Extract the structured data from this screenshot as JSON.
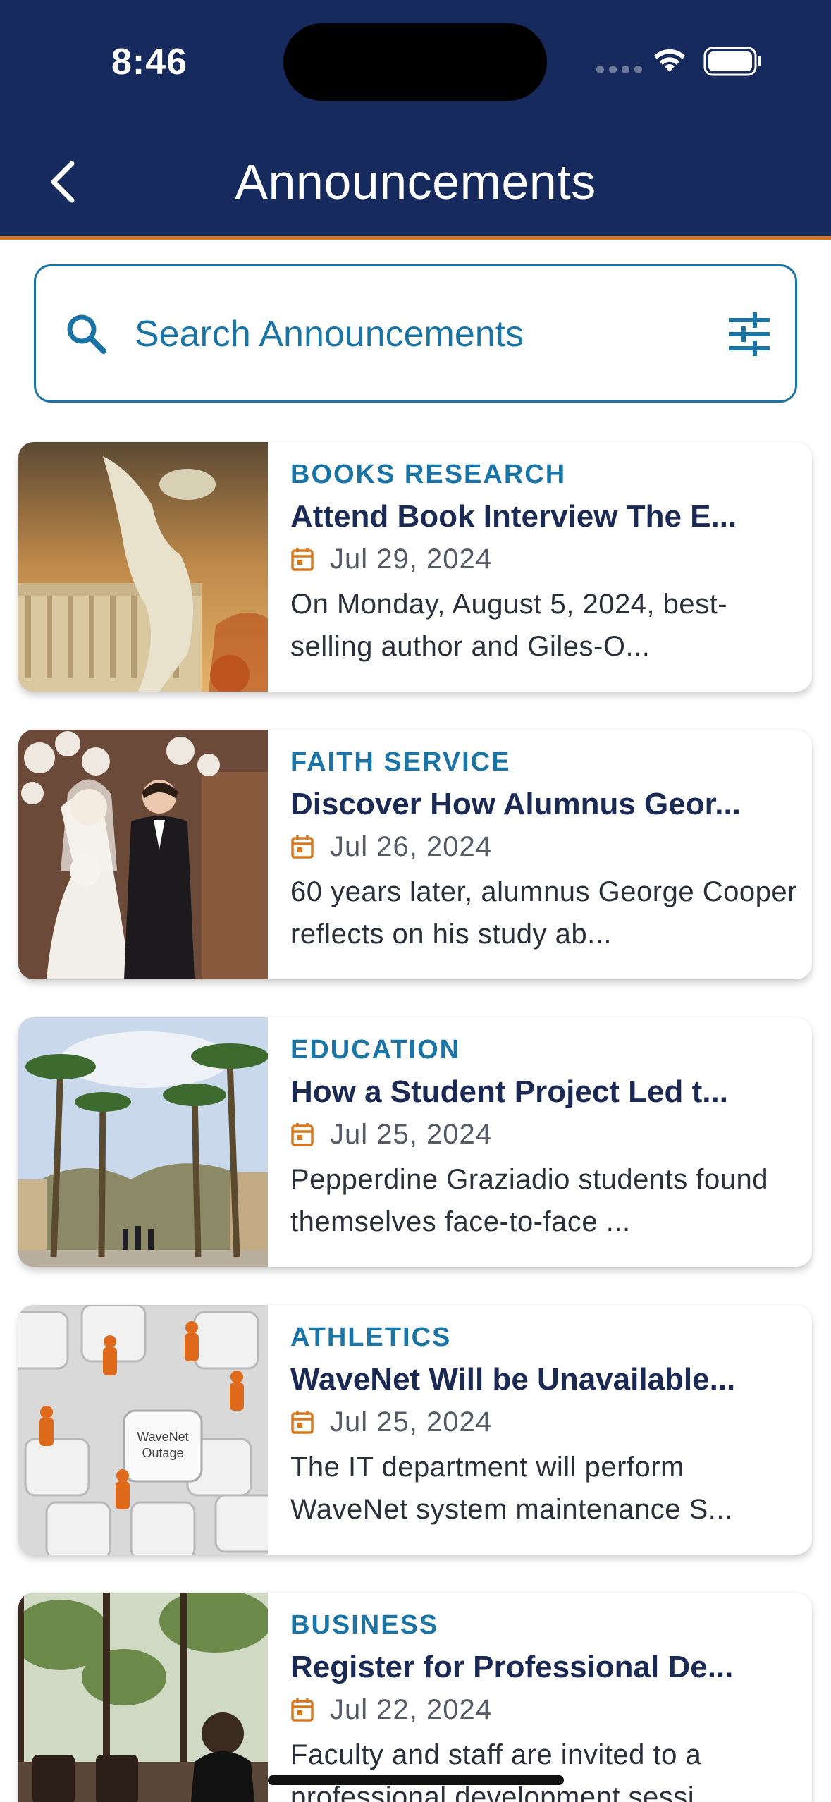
{
  "status_bar": {
    "time": "8:46"
  },
  "header": {
    "title": "Announcements",
    "back_icon": "chevron-left-icon"
  },
  "search": {
    "placeholder": "Search Announcements",
    "value": ""
  },
  "colors": {
    "header_bg": "#172a5e",
    "accent_orange": "#d8781e",
    "link_blue": "#1a74a6",
    "headline_navy": "#1b2a55"
  },
  "announcements": [
    {
      "category": "BOOKS RESEARCH",
      "title": "Attend Book Interview The E...",
      "date": "Jul 29, 2024",
      "summary": "On Monday, August 5, 2024, best-selling author and Giles-O..."
    },
    {
      "category": "FAITH SERVICE",
      "title": "Discover How Alumnus Geor...",
      "date": "Jul 26, 2024",
      "summary": "60 years later, alumnus George Cooper reflects on his study ab..."
    },
    {
      "category": "EDUCATION",
      "title": "How a Student Project Led t...",
      "date": "Jul 25, 2024",
      "summary": "Pepperdine Graziadio students found themselves face-to-face ..."
    },
    {
      "category": "ATHLETICS",
      "title": "WaveNet Will be Unavailable...",
      "date": "Jul 25, 2024",
      "summary": "The IT department will perform WaveNet system maintenance S...",
      "image_text": "WaveNet Outage"
    },
    {
      "category": "BUSINESS",
      "title": "Register for Professional De...",
      "date": "Jul 22, 2024",
      "summary": "Faculty and staff are invited to a professional development sessi..."
    }
  ]
}
